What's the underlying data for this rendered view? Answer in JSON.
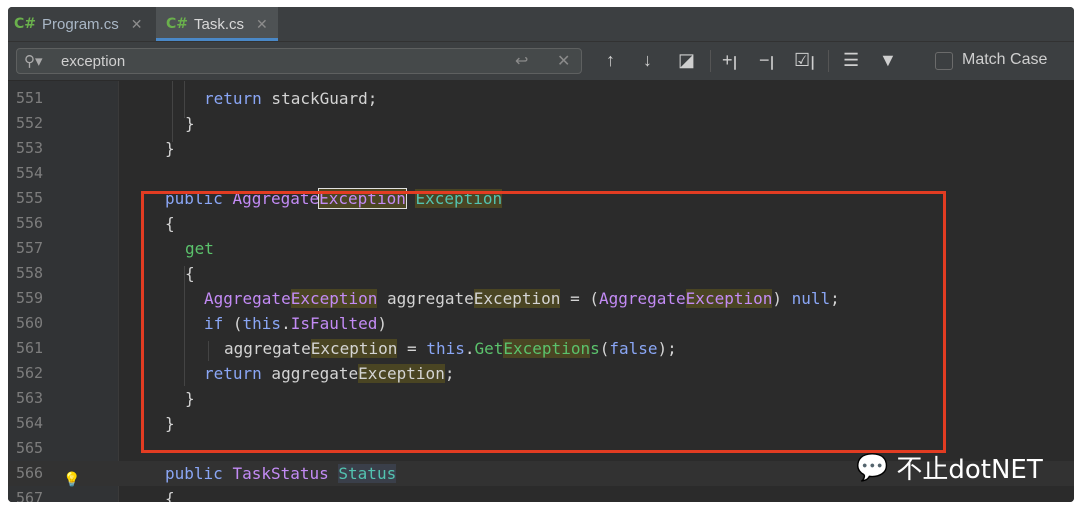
{
  "tabs": [
    {
      "icon": "C#",
      "label": "Program.cs"
    },
    {
      "icon": "C#",
      "label": "Task.cs"
    }
  ],
  "find": {
    "query": "exception",
    "match_case_label": "Match Case"
  },
  "lines": [
    {
      "num": "551"
    },
    {
      "num": "552"
    },
    {
      "num": "553"
    },
    {
      "num": "554"
    },
    {
      "num": "555"
    },
    {
      "num": "556"
    },
    {
      "num": "557"
    },
    {
      "num": "558"
    },
    {
      "num": "559"
    },
    {
      "num": "560"
    },
    {
      "num": "561"
    },
    {
      "num": "562"
    },
    {
      "num": "563"
    },
    {
      "num": "564"
    },
    {
      "num": "565"
    },
    {
      "num": "566"
    },
    {
      "num": "567"
    }
  ],
  "watermark": "不止dotNET"
}
